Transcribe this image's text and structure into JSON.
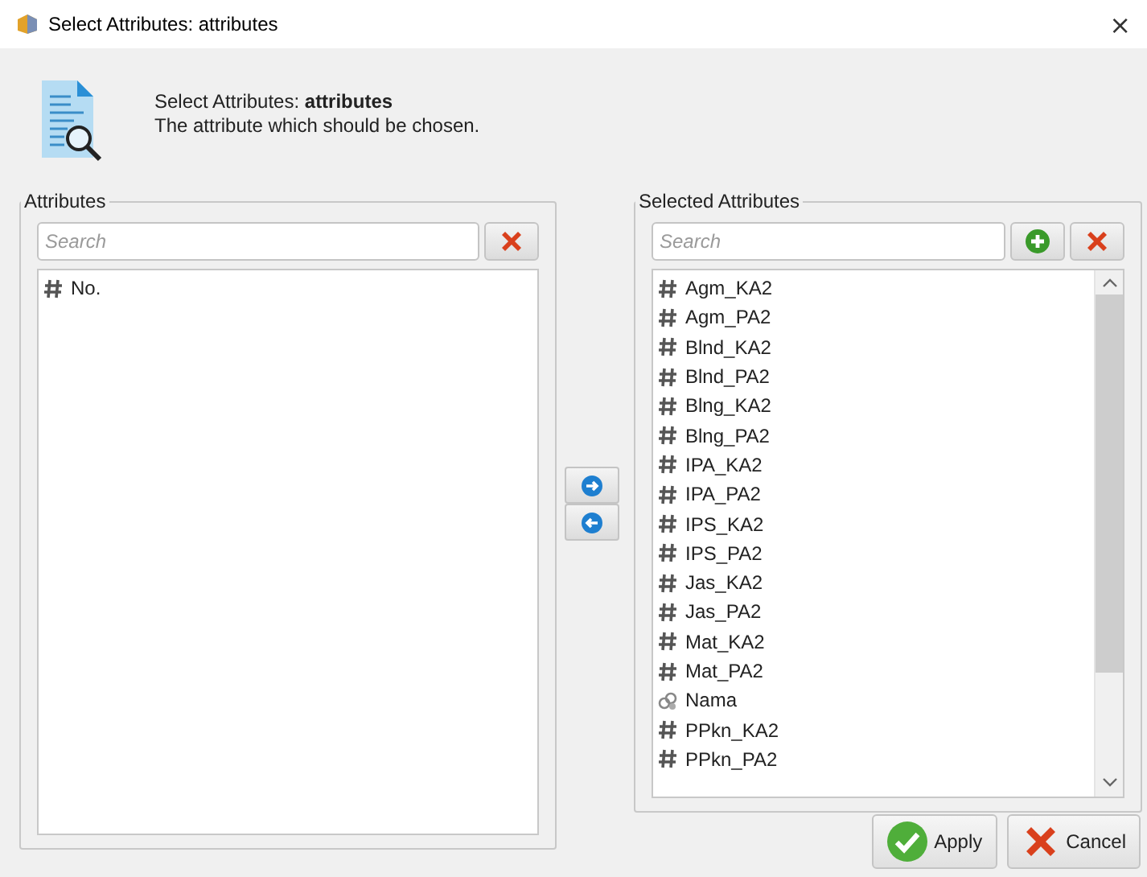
{
  "window": {
    "title": "Select Attributes: attributes",
    "close": "×"
  },
  "header": {
    "title": "Select Attributes: **attributes**",
    "description": "The attribute which should be chosen."
  },
  "available": {
    "label": "Attributes",
    "search": {
      "placeholder": "Search"
    },
    "tools": [
      {
        "kind": "clear"
      }
    ],
    "items": [
      {
        "name": "No.",
        "kind": "numeric"
      }
    ]
  },
  "selected": {
    "label": "Selected Attributes",
    "search": {
      "placeholder": "Search"
    },
    "tools": [
      {
        "kind": "add"
      },
      {
        "kind": "clear"
      }
    ],
    "items": [
      {
        "name": "Agm_KA2",
        "kind": "numeric"
      },
      {
        "name": "Agm_PA2",
        "kind": "numeric"
      },
      {
        "name": "Blnd_KA2",
        "kind": "numeric"
      },
      {
        "name": "Blnd_PA2",
        "kind": "numeric"
      },
      {
        "name": "Blng_KA2",
        "kind": "numeric"
      },
      {
        "name": "Blng_PA2",
        "kind": "numeric"
      },
      {
        "name": "IPA_KA2",
        "kind": "numeric"
      },
      {
        "name": "IPA_PA2",
        "kind": "numeric"
      },
      {
        "name": "IPS_KA2",
        "kind": "numeric"
      },
      {
        "name": "IPS_PA2",
        "kind": "numeric"
      },
      {
        "name": "Jas_KA2",
        "kind": "numeric"
      },
      {
        "name": "Jas_PA2",
        "kind": "numeric"
      },
      {
        "name": "Mat_KA2",
        "kind": "numeric"
      },
      {
        "name": "Mat_PA2",
        "kind": "numeric"
      },
      {
        "name": "Nama",
        "kind": "nominal"
      },
      {
        "name": "PPkn_KA2",
        "kind": "numeric"
      },
      {
        "name": "PPkn_PA2",
        "kind": "numeric"
      }
    ]
  },
  "move": [
    {
      "kind": "right"
    },
    {
      "kind": "left"
    }
  ],
  "buttons": [
    {
      "label": "Apply",
      "kind": "apply"
    },
    {
      "label": "Cancel",
      "kind": "cancel"
    }
  ]
}
